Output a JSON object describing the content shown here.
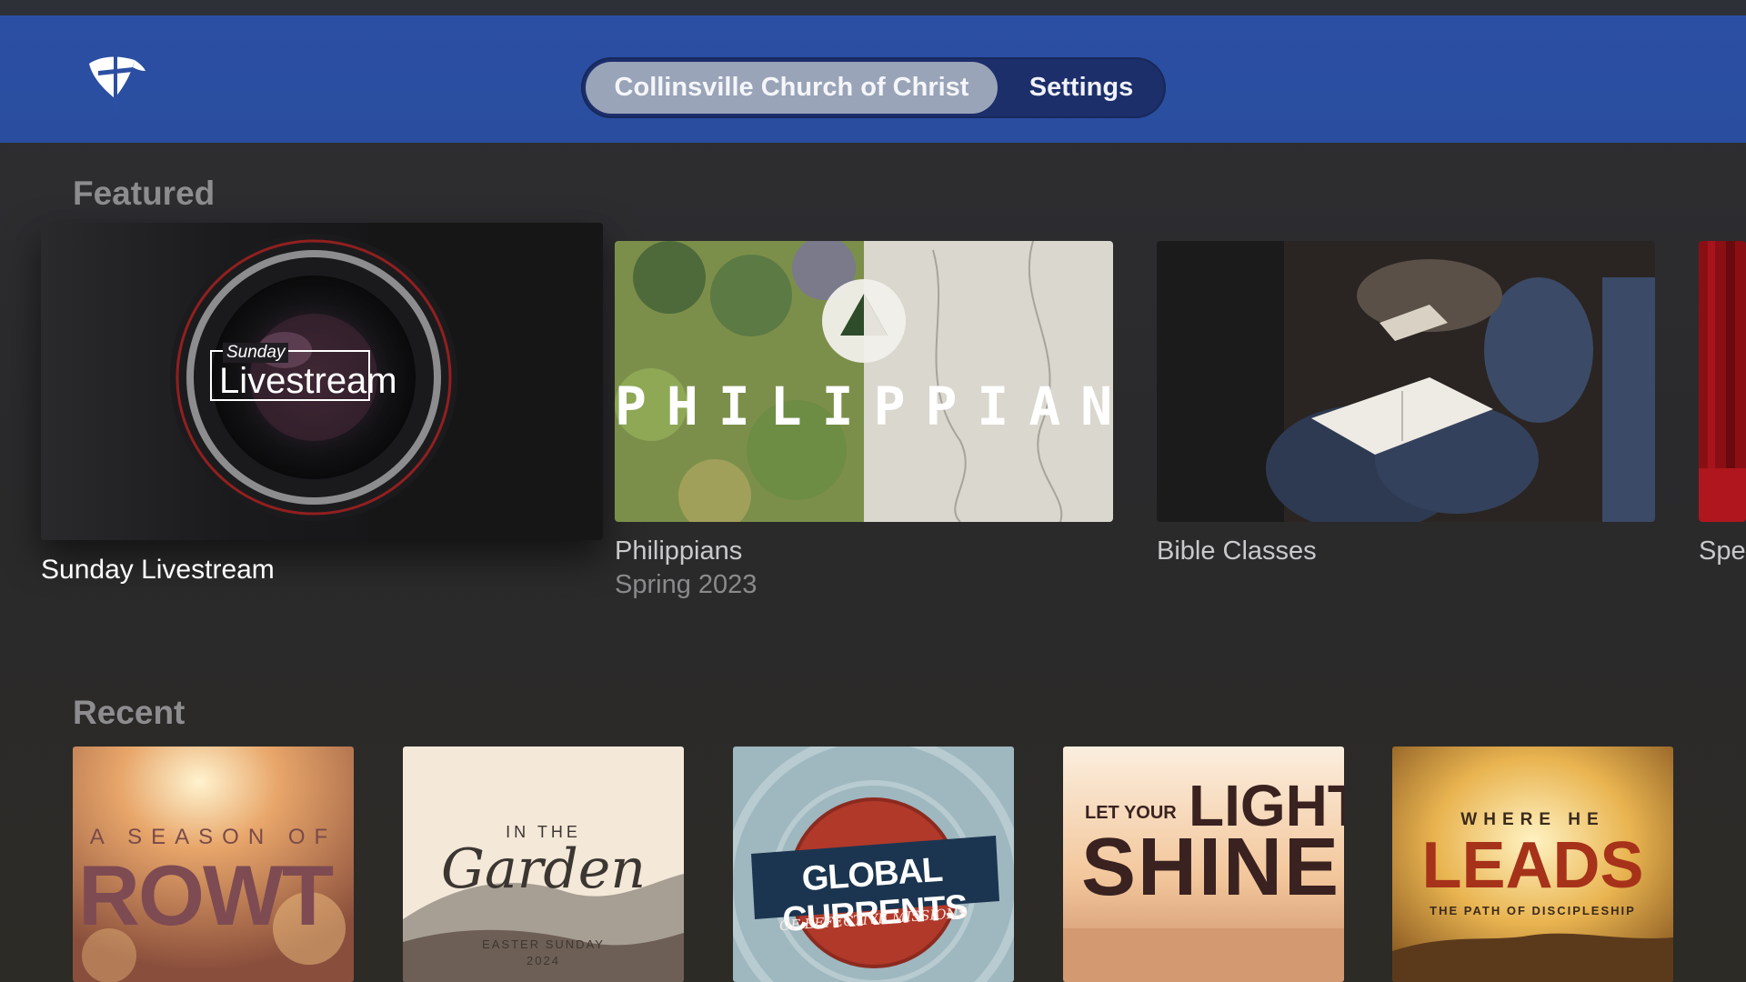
{
  "header": {
    "tabs": [
      {
        "label": "Collinsville Church of Christ",
        "active": true
      },
      {
        "label": "Settings",
        "active": false
      }
    ]
  },
  "featured": {
    "title": "Featured",
    "items": [
      {
        "title": "Sunday Livestream",
        "subtitle": "",
        "art_small": "Sunday",
        "art_large": "Livestream",
        "focused": true
      },
      {
        "title": "Philippians",
        "subtitle": "Spring 2023",
        "art_text": "PHILIPPIANS"
      },
      {
        "title": "Bible Classes",
        "subtitle": ""
      },
      {
        "title": "Spe",
        "subtitle": ""
      }
    ]
  },
  "recent": {
    "title": "Recent",
    "items": [
      {
        "art_line1": "A SEASON OF",
        "art_line2": "ROWT"
      },
      {
        "art_line1": "IN THE",
        "art_line2": "Garden",
        "art_line3": "EASTER SUNDAY",
        "art_line4": "2024"
      },
      {
        "art_line1": "GLOBAL CURRENTS",
        "art_line2": "OF EFFECTIVE MISSIONS"
      },
      {
        "art_line1": "LET YOUR",
        "art_line2": "LIGHT",
        "art_line3": "SHINE"
      },
      {
        "art_line1": "WHERE HE",
        "art_line2": "LEADS",
        "art_line3": "THE PATH OF DISCIPLESHIP"
      }
    ]
  },
  "colors": {
    "header_bg": "#2b4fa3",
    "segment_bg": "#1c2f6b",
    "active_tab": "#9aa4b8",
    "page_bg": "#2c2c2e"
  }
}
